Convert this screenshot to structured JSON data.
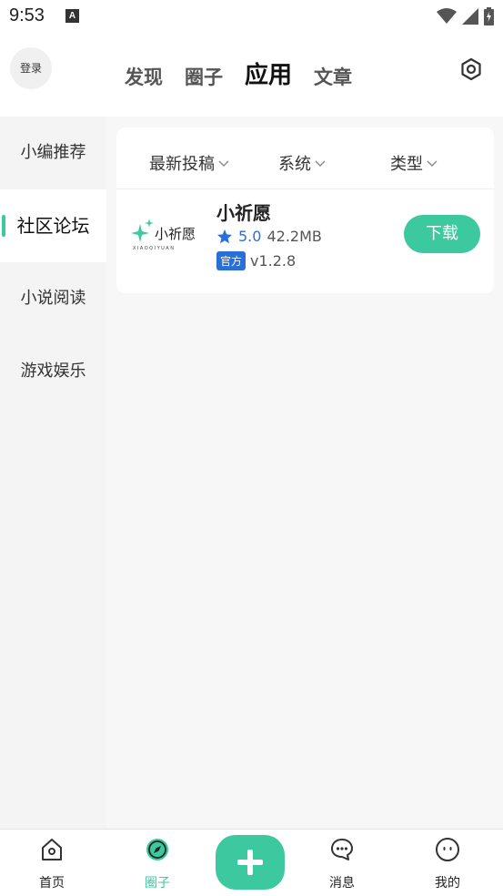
{
  "status_bar": {
    "time": "9:53",
    "indicator": "A"
  },
  "header": {
    "login": "登录",
    "tabs": [
      {
        "label": "发现",
        "active": false
      },
      {
        "label": "圈子",
        "active": false
      },
      {
        "label": "应用",
        "active": true
      },
      {
        "label": "文章",
        "active": false
      }
    ],
    "settings_icon": "settings-icon"
  },
  "sidebar": {
    "items": [
      {
        "label": "小编推荐",
        "active": false
      },
      {
        "label": "社区论坛",
        "active": true
      },
      {
        "label": "小说阅读",
        "active": false
      },
      {
        "label": "游戏娱乐",
        "active": false
      }
    ]
  },
  "filters": {
    "sort": "最新投稿",
    "system": "系统",
    "type": "类型"
  },
  "apps": [
    {
      "name": "小祈愿",
      "logo_text": "小祈愿",
      "logo_subtext": "XIAOQIYUAN",
      "rating": "5.0",
      "size": "42.2MB",
      "badge": "官方",
      "version": "v1.2.8",
      "action": "下载"
    }
  ],
  "bottom_nav": {
    "items": [
      {
        "label": "首页",
        "icon": "home-icon",
        "active": false
      },
      {
        "label": "圈子",
        "icon": "compass-icon",
        "active": true
      },
      {
        "label": "消息",
        "icon": "chat-icon",
        "active": false
      },
      {
        "label": "我的",
        "icon": "face-icon",
        "active": false
      }
    ],
    "add_icon": "plus-icon"
  },
  "colors": {
    "accent": "#3dc9a0",
    "blue": "#2a6fd8",
    "sidebar_bg": "#f4f4f4",
    "content_bg": "#f7f7f7"
  }
}
